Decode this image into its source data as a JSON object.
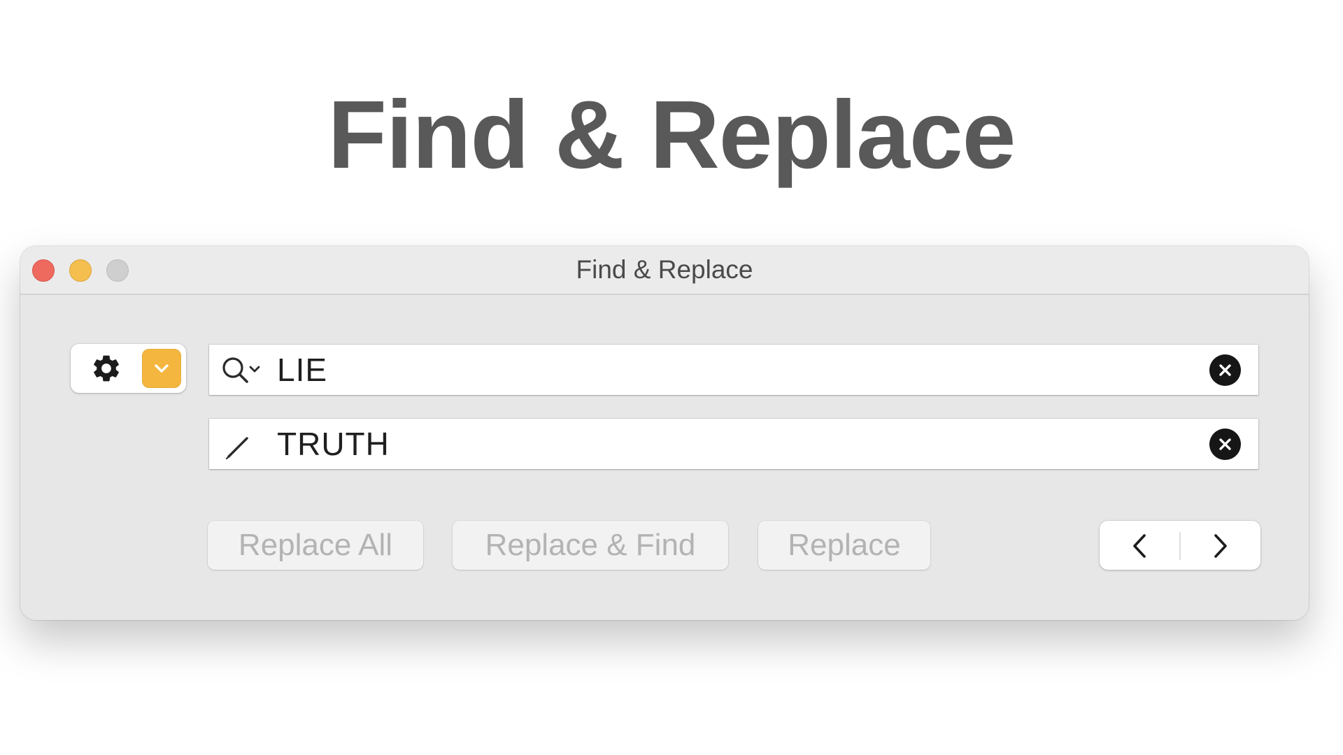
{
  "headline": "Find & Replace",
  "window": {
    "title": "Find & Replace",
    "controls": {
      "close_color": "#ee6a5f",
      "minimize_color": "#f5bf4f",
      "zoom_color": "#cfcfcf"
    }
  },
  "options": {
    "gear_icon": "gear-icon",
    "dropdown_icon": "chevron-down-icon",
    "accent_color": "#f4b63e"
  },
  "find_field": {
    "icon": "search-icon",
    "value": "LIE"
  },
  "replace_field": {
    "icon": "pencil-icon",
    "value": "TRUTH"
  },
  "actions": {
    "replace_all_label": "Replace All",
    "replace_find_label": "Replace & Find",
    "replace_label": "Replace"
  },
  "navigation": {
    "prev_icon": "chevron-left-icon",
    "next_icon": "chevron-right-icon"
  }
}
